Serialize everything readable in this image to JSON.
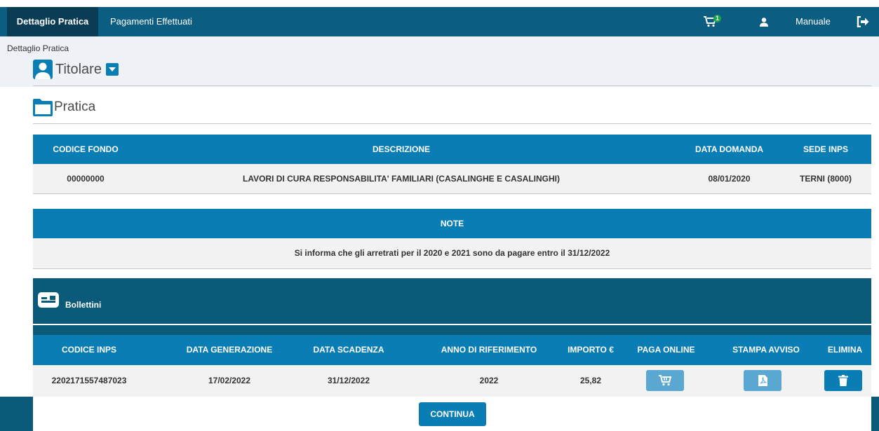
{
  "topbar": {
    "tabs": [
      {
        "label": "Dettaglio Pratica",
        "active": true
      },
      {
        "label": "Pagamenti Effettuati",
        "active": false
      }
    ],
    "cart_count": "1",
    "manual_label": "Manuale"
  },
  "breadcrumb": "Dettaglio Pratica",
  "titolare": {
    "title": "Titolare"
  },
  "pratica": {
    "title": "Pratica",
    "headers": [
      "CODICE FONDO",
      "DESCRIZIONE",
      "DATA DOMANDA",
      "SEDE INPS"
    ],
    "row": [
      "00000000",
      "LAVORI DI CURA RESPONSABILITA' FAMILIARI (CASALINGHE E CASALINGHI)",
      "08/01/2020",
      "TERNI (8000)"
    ]
  },
  "note": {
    "header": "NOTE",
    "text": "Si informa che gli arretrati per il 2020 e 2021 sono da pagare entro il 31/12/2022"
  },
  "bollettini": {
    "title": "Bollettini",
    "headers": [
      "CODICE INPS",
      "DATA GENERAZIONE",
      "DATA SCADENZA",
      "ANNO DI RIFERIMENTO",
      "IMPORTO €",
      "PAGA ONLINE",
      "STAMPA AVVISO",
      "ELIMINA"
    ],
    "rows": [
      [
        "2202171557487023",
        "17/02/2022",
        "31/12/2022",
        "2022",
        "25,82"
      ]
    ]
  },
  "continue_label": "CONTINUA",
  "colors": {
    "primary": "#0b5d82",
    "header": "#0b7db5",
    "dark": "#0a3c55",
    "badge": "#16a34a"
  }
}
